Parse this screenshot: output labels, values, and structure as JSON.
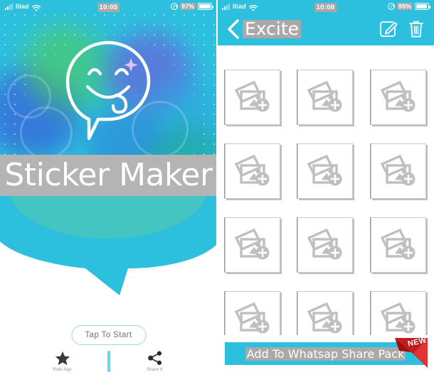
{
  "left": {
    "statusbar": {
      "carrier": "Iliad",
      "time": "10:05",
      "battery_pct": "97%",
      "wifi_icon": "wifi-icon",
      "signal_icon": "signal-bars-icon",
      "rotation_lock_icon": "rotation-lock-icon",
      "battery_icon": "battery-icon"
    },
    "logo_icon": "speech-bubble-smiley-icon",
    "app_title": "Sticker Maker",
    "start_button": "Tap To Start",
    "footer": [
      {
        "label": "Rate App",
        "icon": "star-icon"
      },
      {
        "label": "Share It",
        "icon": "share-icon"
      }
    ]
  },
  "right": {
    "statusbar": {
      "carrier": "Iliad",
      "time": "10:08",
      "battery_pct": "95%",
      "wifi_icon": "wifi-icon",
      "signal_icon": "signal-bars-icon",
      "rotation_lock_icon": "rotation-lock-icon",
      "battery_icon": "battery-icon"
    },
    "header": {
      "back_icon": "back-chevron-icon",
      "title": "Excite",
      "edit_icon": "edit-pencil-icon",
      "delete_icon": "trash-icon"
    },
    "grid": {
      "rows": 4,
      "columns": 3,
      "tile_icon": "add-photo-icon",
      "tiles": [
        "add-sticker-slot",
        "add-sticker-slot",
        "add-sticker-slot",
        "add-sticker-slot",
        "add-sticker-slot",
        "add-sticker-slot",
        "add-sticker-slot",
        "add-sticker-slot",
        "add-sticker-slot",
        "add-sticker-slot",
        "add-sticker-slot",
        "add-sticker-slot"
      ]
    },
    "share_button": {
      "label": "Add To Whatsap Share Pack",
      "badge": "NEW"
    }
  },
  "colors": {
    "accent_cyan": "#2cc0de",
    "highlight_gray": "#a9a9a9",
    "title_band_gray": "#b4b4b4",
    "tile_border": "#c9c9c9",
    "ribbon_red": "#d51b1b"
  }
}
